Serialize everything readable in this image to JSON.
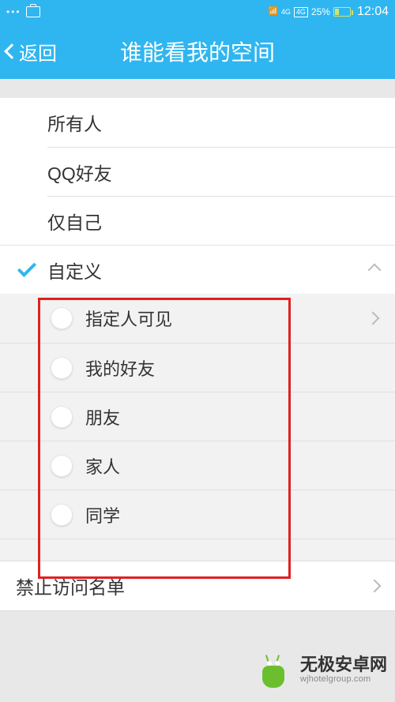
{
  "status": {
    "network_label": "4G",
    "battery_pct": "25%",
    "time": "12:04"
  },
  "nav": {
    "back_label": "返回",
    "title": "谁能看我的空间"
  },
  "options": {
    "everyone": "所有人",
    "qq_friends": "QQ好友",
    "only_me": "仅自己",
    "custom": "自定义"
  },
  "custom_sub": [
    {
      "label": "指定人可见"
    },
    {
      "label": "我的好友"
    },
    {
      "label": "朋友"
    },
    {
      "label": "家人"
    },
    {
      "label": "同学"
    }
  ],
  "block_list_label": "禁止访问名单",
  "watermark": {
    "cn": "无极安卓网",
    "en": "wjhotelgroup.com"
  }
}
